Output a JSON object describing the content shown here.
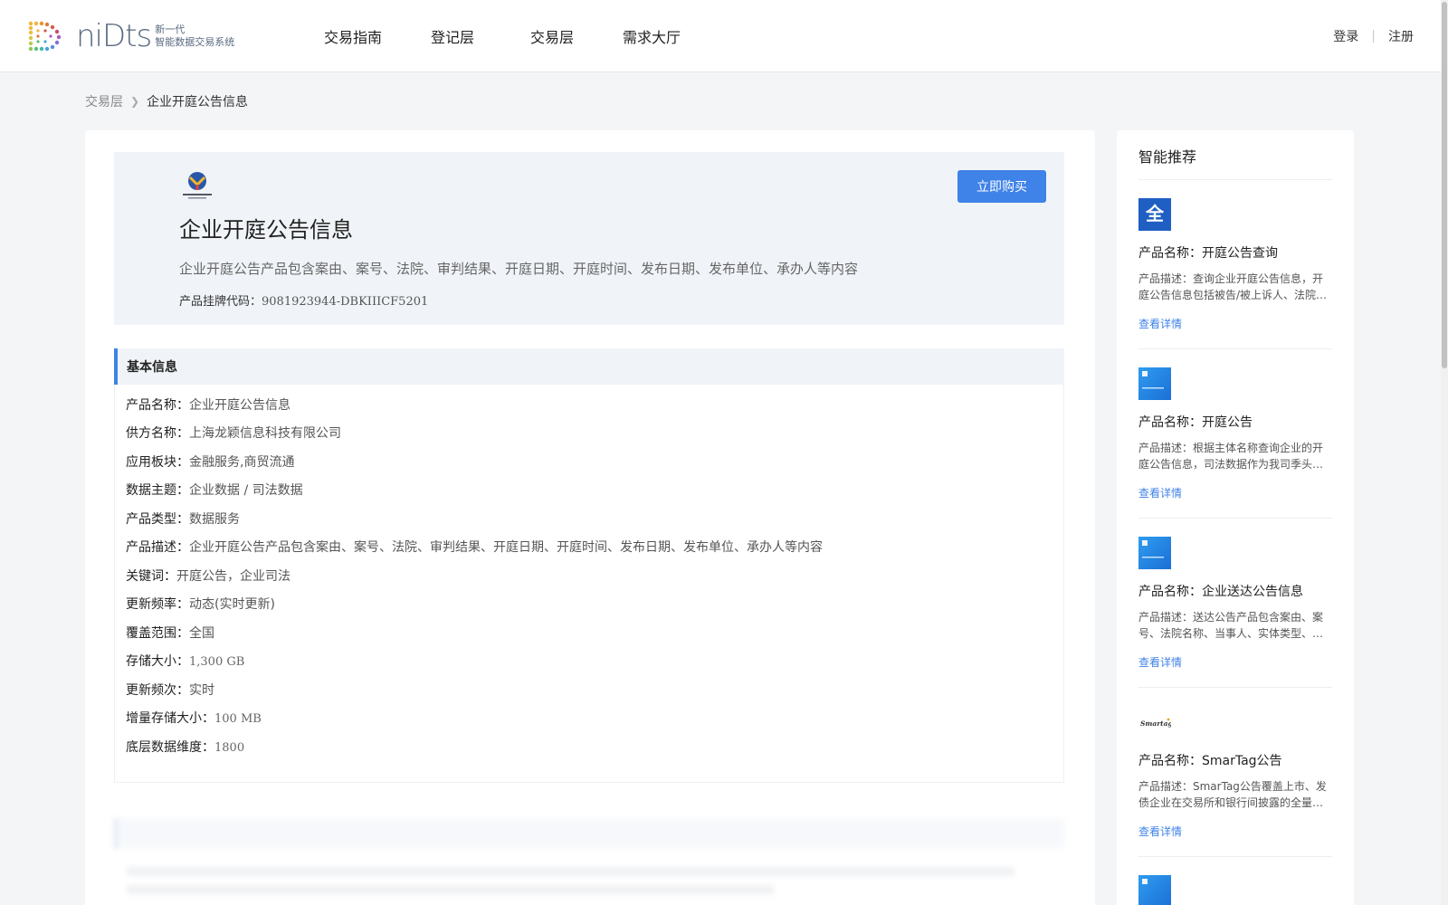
{
  "header": {
    "brand": "niDts",
    "brand_sub1": "新一代",
    "brand_sub2": "智能数据交易系统",
    "nav": [
      "交易指南",
      "登记层",
      "交易层",
      "需求大厅"
    ],
    "login": "登录",
    "register": "注册"
  },
  "breadcrumb": {
    "parent": "交易层",
    "current": "企业开庭公告信息"
  },
  "product": {
    "title": "企业开庭公告信息",
    "description": "企业开庭公告产品包含案由、案号、法院、审判结果、开庭日期、开庭时间、发布日期、发布单位、承办人等内容",
    "code_label": "产品挂牌代码：",
    "code_value": "9081923944-DBKIIICF5201",
    "buy_label": "立即购买"
  },
  "basic_info": {
    "title": "基本信息",
    "rows": [
      {
        "label": "产品名称：",
        "value": "企业开庭公告信息"
      },
      {
        "label": "供方名称：",
        "value": "上海龙颖信息科技有限公司"
      },
      {
        "label": "应用板块：",
        "value": "金融服务,商贸流通"
      },
      {
        "label": "数据主题：",
        "value": "企业数据 / 司法数据"
      },
      {
        "label": "产品类型：",
        "value": "数据服务"
      },
      {
        "label": "产品描述：",
        "value": "企业开庭公告产品包含案由、案号、法院、审判结果、开庭日期、开庭时间、发布日期、发布单位、承办人等内容"
      },
      {
        "label": "关键词：",
        "value": "开庭公告，企业司法"
      },
      {
        "label": "更新频率：",
        "value": "动态(实时更新)"
      },
      {
        "label": "覆盖范围：",
        "value": "全国"
      },
      {
        "label": "存储大小：",
        "value": "1,300 GB"
      },
      {
        "label": "更新频次：",
        "value": "实时"
      },
      {
        "label": "增量存储大小：",
        "value": "100 MB"
      },
      {
        "label": "底层数据维度：",
        "value": "1800"
      }
    ]
  },
  "side": {
    "title": "智能推荐",
    "items": [
      {
        "name": "产品名称：开庭公告查询",
        "desc": "产品描述：查询企业开庭公告信息，开庭公告信息包括被告/被上诉人、法院名称等",
        "link": "查看详情"
      },
      {
        "name": "产品名称：开庭公告",
        "desc": "产品描述：根据主体名称查询企业的开庭公告信息，司法数据作为我司季头产品",
        "link": "查看详情"
      },
      {
        "name": "产品名称：企业送达公告信息",
        "desc": "产品描述：送达公告产品包含案由、案号、法院名称、当事人、实体类型、公告内容",
        "link": "查看详情"
      },
      {
        "name": "产品名称：SmarTag公告",
        "desc": "产品描述：SmarTag公告覆盖上市、发债企业在交易所和银行间披露的全量公告信息",
        "link": "查看详情"
      }
    ]
  },
  "colors": {
    "accent": "#3f82e8",
    "hero_bg": "#f0f4f8"
  }
}
